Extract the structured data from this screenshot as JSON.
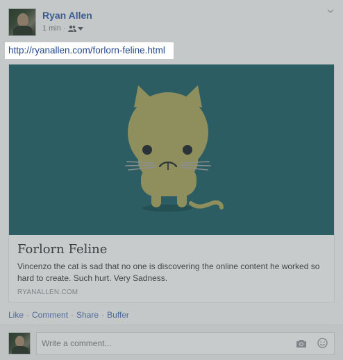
{
  "post": {
    "author": "Ryan Allen",
    "time": "1 min",
    "separator": "·",
    "audience_icon": "friends-icon",
    "menu_icon": "chevron-down-icon"
  },
  "link": {
    "url": "http://ryanallen.com/forlorn-feline.html"
  },
  "preview": {
    "title": "Forlorn Feline",
    "description": "Vincenzo the cat is sad that no one is discovering the online content he worked so hard to create. Such hurt. Very Sadness.",
    "domain": "RYANALLEN.COM",
    "image_bg": "#2b5d62",
    "cat_color": "#8f8f5d"
  },
  "actions": {
    "like": "Like",
    "comment": "Comment",
    "share": "Share",
    "buffer": "Buffer",
    "separator": "·"
  },
  "comment_box": {
    "placeholder": "Write a comment...",
    "icons": [
      "camera-icon",
      "emoji-icon"
    ]
  },
  "colors": {
    "link_blue": "#3b5a8f",
    "background": "#c5c8c9"
  }
}
